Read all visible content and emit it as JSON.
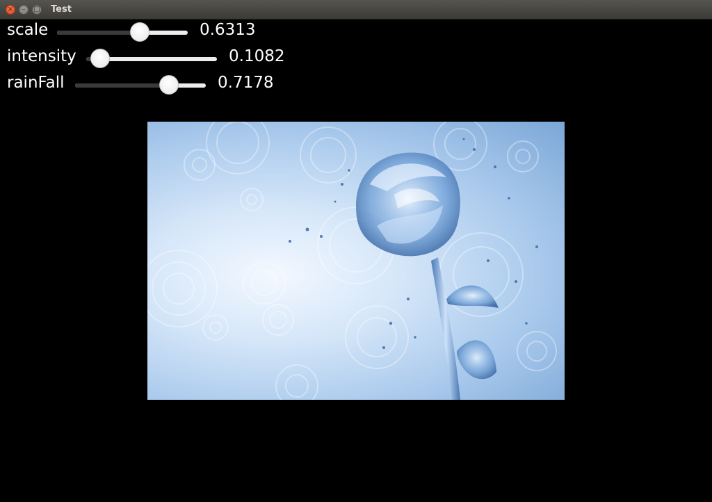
{
  "window": {
    "title": "Test",
    "close_glyph": "×",
    "min_glyph": "–",
    "max_glyph": "□",
    "icons": [
      "close-icon",
      "minimize-icon",
      "maximize-icon"
    ]
  },
  "sliders": [
    {
      "label": "scale",
      "value_text": "0.6313",
      "value": 0.6313
    },
    {
      "label": "intensity",
      "value_text": "0.1082",
      "value": 0.1082
    },
    {
      "label": "rainFall",
      "value_text": "0.7178",
      "value": 0.7178
    }
  ],
  "colors": {
    "background": "#000000",
    "titlebar": "#3c3b37",
    "close_button": "#e0461e",
    "track": "#ececec",
    "track_fill": "#3a3a3a",
    "text": "#ffffff"
  }
}
